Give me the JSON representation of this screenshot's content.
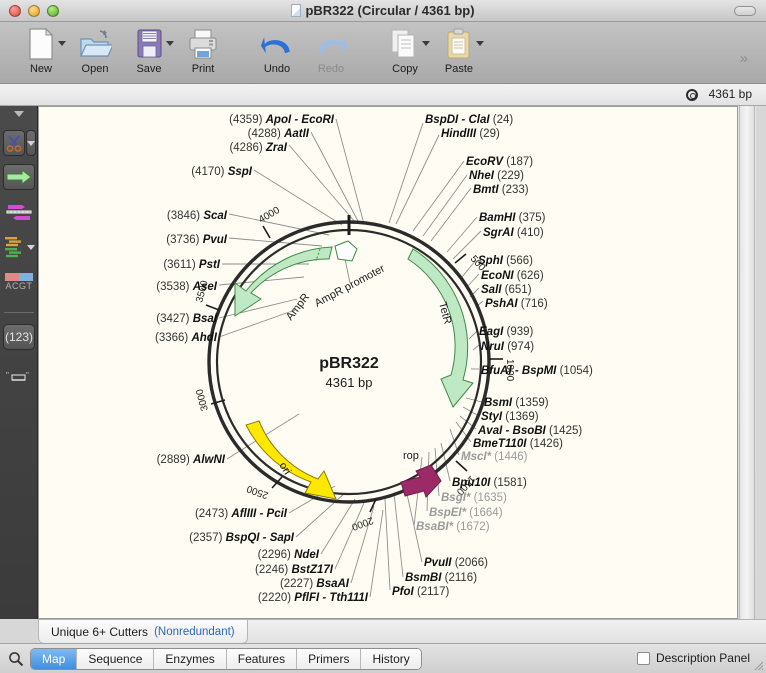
{
  "window": {
    "title": "pBR322  (Circular / 4361 bp)",
    "doc_icon": "document-icon",
    "traffic_lights": [
      "close",
      "minimize",
      "zoom"
    ]
  },
  "toolbar": {
    "items": [
      {
        "label": "New",
        "icon": "new-document-icon",
        "has_menu": true,
        "disabled": false
      },
      {
        "label": "Open",
        "icon": "open-folder-icon",
        "has_menu": false,
        "disabled": false
      },
      {
        "label": "Save",
        "icon": "floppy-disk-icon",
        "has_menu": true,
        "disabled": false
      },
      {
        "label": "Print",
        "icon": "printer-icon",
        "has_menu": false,
        "disabled": false
      },
      {
        "label": "Undo",
        "icon": "undo-arrow-icon",
        "has_menu": false,
        "disabled": false
      },
      {
        "label": "Redo",
        "icon": "redo-arrow-icon",
        "has_menu": false,
        "disabled": true
      },
      {
        "label": "Copy",
        "icon": "copy-pages-icon",
        "has_menu": true,
        "disabled": true
      },
      {
        "label": "Paste",
        "icon": "clipboard-icon",
        "has_menu": true,
        "disabled": true
      }
    ],
    "overflow": "»"
  },
  "bpbar": {
    "icon": "circular-plasmid-icon",
    "length_label": "4361 bp"
  },
  "palette": {
    "collapse_icon": "triangle-down-icon",
    "items": [
      {
        "icon": "scissors-icon",
        "has_menu": true
      },
      {
        "icon": "green-arrow-icon",
        "has_menu": false
      },
      {
        "icon": "primer-pair-icon",
        "has_menu": false
      },
      {
        "icon": "alignment-icon",
        "has_menu": true
      },
      {
        "icon": "acgt-icon",
        "label": "ACGT"
      },
      {
        "icon": "numbering-icon",
        "label": "(123)"
      },
      {
        "icon": "linear-map-icon",
        "has_menu": false
      }
    ]
  },
  "map": {
    "center_title": "pBR322",
    "center_subtitle": "4361 bp",
    "background_color": "#fffdf3",
    "tick_labels": [
      "500",
      "1000",
      "1500",
      "2000",
      "2500",
      "3000",
      "3500",
      "4000"
    ],
    "features": [
      {
        "name": "AmpR",
        "color": "#bfe9c4",
        "label": "AmpR"
      },
      {
        "name": "AmpR promoter",
        "color": "#ffffff",
        "label": "AmpR promoter"
      },
      {
        "name": "TetR",
        "color": "#bfe9c4",
        "label": "TetR"
      },
      {
        "name": "ori",
        "color": "#ffe800",
        "label": "ori"
      },
      {
        "name": "rop",
        "color": "#9c2a66",
        "label": "rop"
      }
    ],
    "sites": [
      {
        "name": "ApoI - EcoRI",
        "position": "(4359)",
        "order": "pos-first",
        "dim": false
      },
      {
        "name": "AatII",
        "position": "(4288)",
        "order": "pos-first",
        "dim": false
      },
      {
        "name": "ZraI",
        "position": "(4286)",
        "order": "pos-first",
        "dim": false
      },
      {
        "name": "SspI",
        "position": "(4170)",
        "order": "pos-first",
        "dim": false
      },
      {
        "name": "ScaI",
        "position": "(3846)",
        "order": "pos-first",
        "dim": false
      },
      {
        "name": "PvuI",
        "position": "(3736)",
        "order": "pos-first",
        "dim": false
      },
      {
        "name": "PstI",
        "position": "(3611)",
        "order": "pos-first",
        "dim": false
      },
      {
        "name": "AseI",
        "position": "(3538)",
        "order": "pos-first",
        "dim": false
      },
      {
        "name": "BsaI",
        "position": "(3427)",
        "order": "pos-first",
        "dim": false
      },
      {
        "name": "AhdI",
        "position": "(3366)",
        "order": "pos-first",
        "dim": false
      },
      {
        "name": "AlwNI",
        "position": "(2889)",
        "order": "pos-first",
        "dim": false
      },
      {
        "name": "AflIII - PciI",
        "position": "(2473)",
        "order": "pos-first",
        "dim": false
      },
      {
        "name": "BspQI - SapI",
        "position": "(2357)",
        "order": "pos-first",
        "dim": false
      },
      {
        "name": "NdeI",
        "position": "(2296)",
        "order": "pos-first",
        "dim": false
      },
      {
        "name": "BstZ17I",
        "position": "(2246)",
        "order": "pos-first",
        "dim": false
      },
      {
        "name": "BsaAI",
        "position": "(2227)",
        "order": "pos-first",
        "dim": false
      },
      {
        "name": "PflFI - Tth111I",
        "position": "(2220)",
        "order": "pos-first",
        "dim": false
      },
      {
        "name": "BspDI - ClaI",
        "position": "(24)",
        "order": "name-first",
        "dim": false
      },
      {
        "name": "HindIII",
        "position": "(29)",
        "order": "name-first",
        "dim": false
      },
      {
        "name": "EcoRV",
        "position": "(187)",
        "order": "name-first",
        "dim": false
      },
      {
        "name": "NheI",
        "position": "(229)",
        "order": "name-first",
        "dim": false
      },
      {
        "name": "BmtI",
        "position": "(233)",
        "order": "name-first",
        "dim": false
      },
      {
        "name": "BamHI",
        "position": "(375)",
        "order": "name-first",
        "dim": false
      },
      {
        "name": "SgrAI",
        "position": "(410)",
        "order": "name-first",
        "dim": false
      },
      {
        "name": "SphI",
        "position": "(566)",
        "order": "name-first",
        "dim": false
      },
      {
        "name": "EcoNI",
        "position": "(626)",
        "order": "name-first",
        "dim": false
      },
      {
        "name": "SalI",
        "position": "(651)",
        "order": "name-first",
        "dim": false
      },
      {
        "name": "PshAI",
        "position": "(716)",
        "order": "name-first",
        "dim": false
      },
      {
        "name": "EagI",
        "position": "(939)",
        "order": "name-first",
        "dim": false
      },
      {
        "name": "NruI",
        "position": "(974)",
        "order": "name-first",
        "dim": false
      },
      {
        "name": "BfuAI - BspMI",
        "position": "(1054)",
        "order": "name-first",
        "dim": false
      },
      {
        "name": "BsmI",
        "position": "(1359)",
        "order": "name-first",
        "dim": false
      },
      {
        "name": "StyI",
        "position": "(1369)",
        "order": "name-first",
        "dim": false
      },
      {
        "name": "AvaI - BsoBI",
        "position": "(1425)",
        "order": "name-first",
        "dim": false
      },
      {
        "name": "BmeT110I",
        "position": "(1426)",
        "order": "name-first",
        "dim": false
      },
      {
        "name": "MscI*",
        "position": "(1446)",
        "order": "name-first",
        "dim": true
      },
      {
        "name": "Bpu10I",
        "position": "(1581)",
        "order": "name-first",
        "dim": false
      },
      {
        "name": "BsgI*",
        "position": "(1635)",
        "order": "name-first",
        "dim": true
      },
      {
        "name": "BspEI*",
        "position": "(1664)",
        "order": "name-first",
        "dim": true
      },
      {
        "name": "BsaBI*",
        "position": "(1672)",
        "order": "name-first",
        "dim": true
      },
      {
        "name": "PvuII",
        "position": "(2066)",
        "order": "name-first",
        "dim": false
      },
      {
        "name": "BsmBI",
        "position": "(2116)",
        "order": "name-first",
        "dim": false
      },
      {
        "name": "PfoI",
        "position": "(2117)",
        "order": "name-first",
        "dim": false
      }
    ]
  },
  "statusrow": {
    "filter_label": "Unique 6+ Cutters",
    "filter_sub": "(Nonredundant)"
  },
  "bottombar": {
    "search_icon": "magnifier-icon",
    "tabs": [
      {
        "label": "Map",
        "active": true
      },
      {
        "label": "Sequence",
        "active": false
      },
      {
        "label": "Enzymes",
        "active": false
      },
      {
        "label": "Features",
        "active": false
      },
      {
        "label": "Primers",
        "active": false
      },
      {
        "label": "History",
        "active": false
      }
    ],
    "description_panel": {
      "label": "Description Panel",
      "checked": false
    }
  }
}
